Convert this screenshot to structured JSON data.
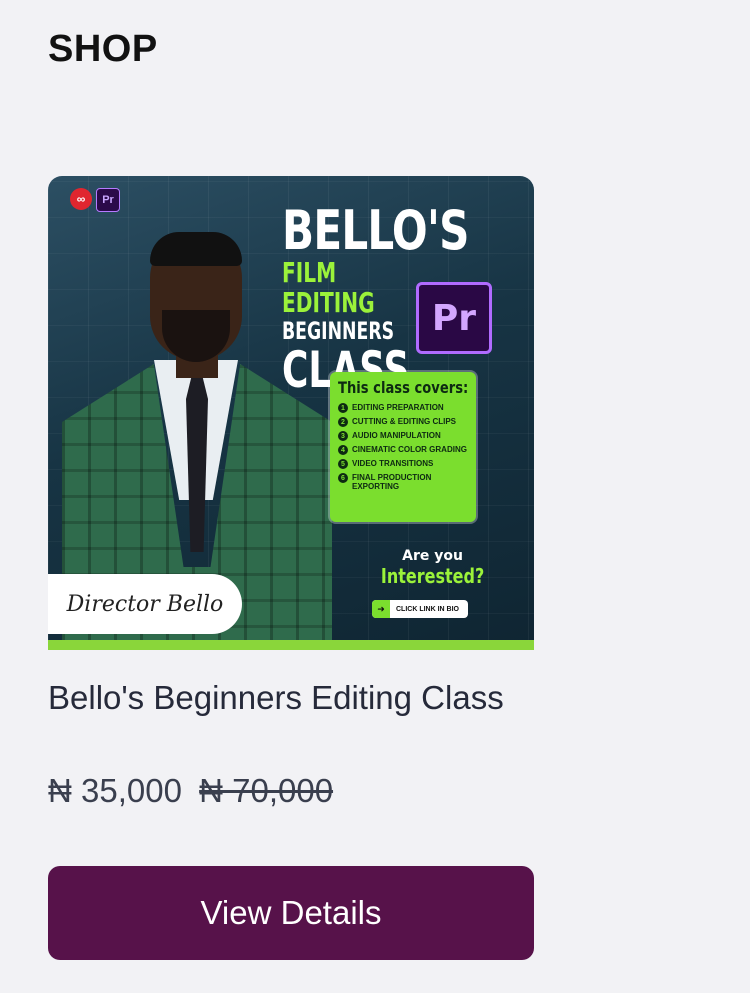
{
  "header": {
    "title": "SHOP"
  },
  "product": {
    "image": {
      "headline_line1": "BELLO'S",
      "headline_line2": "FILM EDITING",
      "headline_line3": "BEGINNERS",
      "headline_line4": "CLASS",
      "app_badge": "Pr",
      "covers_title": "This class covers:",
      "covers": [
        "EDITING PREPARATION",
        "CUTTING & EDITING CLIPS",
        "AUDIO MANIPULATION",
        "CINEMATIC COLOR GRADING",
        "VIDEO TRANSITIONS",
        "FINAL PRODUCTION EXPORTING"
      ],
      "interested_line1": "Are you",
      "interested_line2": "Interested?",
      "cta": "CLICK LINK IN BIO",
      "signature": "Director Bello"
    },
    "title": "Bello's Beginners Editing Class",
    "price_current": "₦ 35,000",
    "price_original": "₦ 70,000",
    "button_label": "View Details"
  },
  "colors": {
    "button": "#57124a",
    "accent_green": "#7bde2e"
  }
}
